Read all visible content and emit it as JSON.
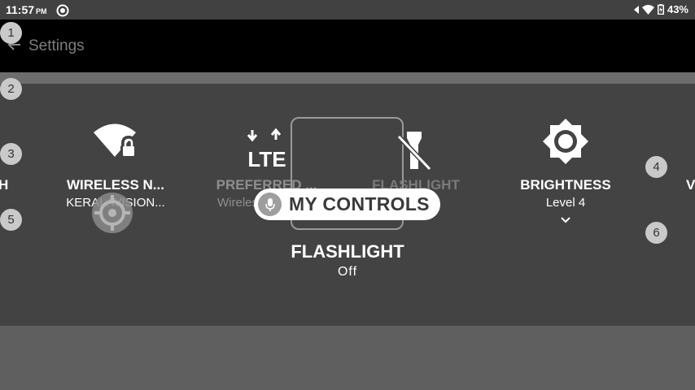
{
  "status_bar": {
    "time": "11:57",
    "ampm": "PM",
    "battery": "43%"
  },
  "app_bar": {
    "title": "Settings"
  },
  "tiles": [
    {
      "label": "H",
      "icon": "partial-tile"
    },
    {
      "label": "WIRELESS N...",
      "sub": "KERALAVISION...",
      "icon": "wifi-lock-icon"
    },
    {
      "label": "PREFERRED ...",
      "sub": "Wireless",
      "icon": "lte-icon"
    },
    {
      "label": "FLASHLIGHT",
      "icon": "flashlight-off-icon"
    },
    {
      "label": "BRIGHTNESS",
      "sub": "Level 4",
      "icon": "brightness-icon"
    },
    {
      "label": "V",
      "icon": "partial-tile"
    }
  ],
  "focused": {
    "title": "FLASHLIGHT",
    "state": "Off"
  },
  "pill": {
    "label": "MY CONTROLS",
    "icon": "mic-icon"
  },
  "markers": [
    "1",
    "2",
    "3",
    "4",
    "5",
    "6"
  ],
  "colors": {
    "status_bar": "#414141",
    "app_bar": "#000000",
    "panel": "#434343",
    "background": "#5f5f5f"
  }
}
